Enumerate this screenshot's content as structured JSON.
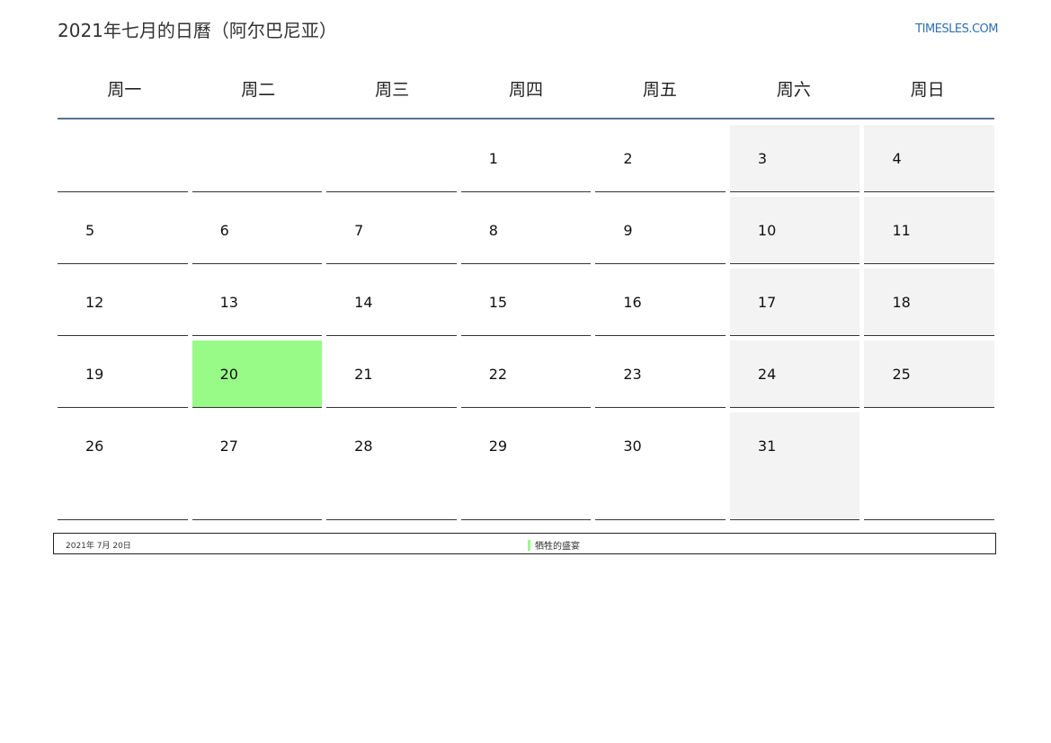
{
  "title": "2021年七月的日曆（阿尔巴尼亚）",
  "site": "TIMESLES.COM",
  "weekdays": [
    "周一",
    "周二",
    "周三",
    "周四",
    "周五",
    "周六",
    "周日"
  ],
  "weeks": [
    [
      "",
      "",
      "",
      "1",
      "2",
      "3",
      "4"
    ],
    [
      "5",
      "6",
      "7",
      "8",
      "9",
      "10",
      "11"
    ],
    [
      "12",
      "13",
      "14",
      "15",
      "16",
      "17",
      "18"
    ],
    [
      "19",
      "20",
      "21",
      "22",
      "23",
      "24",
      "25"
    ],
    [
      "26",
      "27",
      "28",
      "29",
      "30",
      "31",
      ""
    ]
  ],
  "highlight_day": "20",
  "footer": {
    "date": "2021年 7月 20日",
    "legend_label": "牺牲的盛宴"
  },
  "colors": {
    "highlight": "#98fb88",
    "weekend": "#f3f3f3",
    "header_rule": "#5a7394",
    "link": "#2f6fb0"
  }
}
